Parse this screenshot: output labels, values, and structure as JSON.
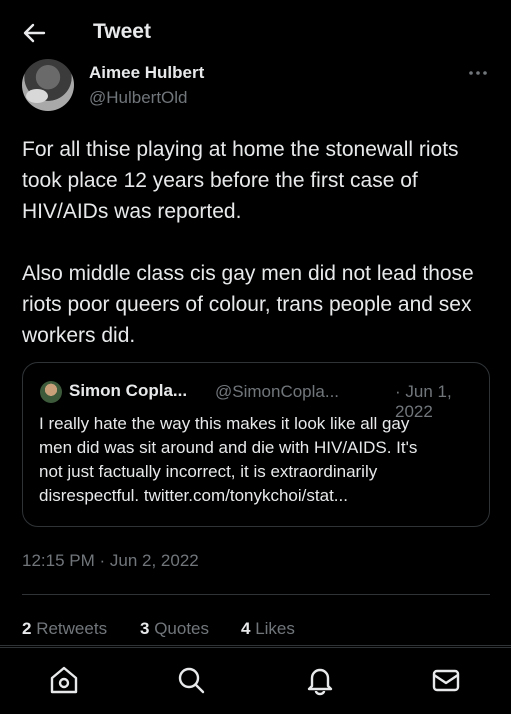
{
  "header": {
    "title": "Tweet"
  },
  "tweet": {
    "author_name": "Aimee Hulbert",
    "author_handle": "@HulbertOld",
    "text": "For all thise playing at home the stonewall riots took place 12 years before the first case of HIV/AIDs was reported.\n\nAlso middle class cis gay men did not lead those riots poor queers of colour, trans people and sex workers did.",
    "timestamp": "12:15 PM · Jun 2, 2022"
  },
  "quote": {
    "author_name": "Simon Copla...",
    "author_handle": "@SimonCopla...",
    "date": "· Jun 1, 2022",
    "text": "I really hate the way this makes it look like all gay\nmen did was sit around and die with HIV/AIDS. It's\nnot just factually incorrect, it is extraordinarily\ndisrespectful. twitter.com/tonykchoi/stat..."
  },
  "stats": {
    "retweets_count": "2",
    "retweets_label": "Retweets",
    "quotes_count": "3",
    "quotes_label": "Quotes",
    "likes_count": "4",
    "likes_label": "Likes"
  },
  "icons": {
    "back": "arrow-left-icon",
    "more": "more-horizontal-icon",
    "home": "home-icon",
    "search": "search-icon",
    "notifications": "bell-icon",
    "messages": "mail-icon"
  },
  "colors": {
    "background": "#000000",
    "text": "#e7e9ea",
    "muted": "#71767b",
    "border": "#2f3336"
  }
}
